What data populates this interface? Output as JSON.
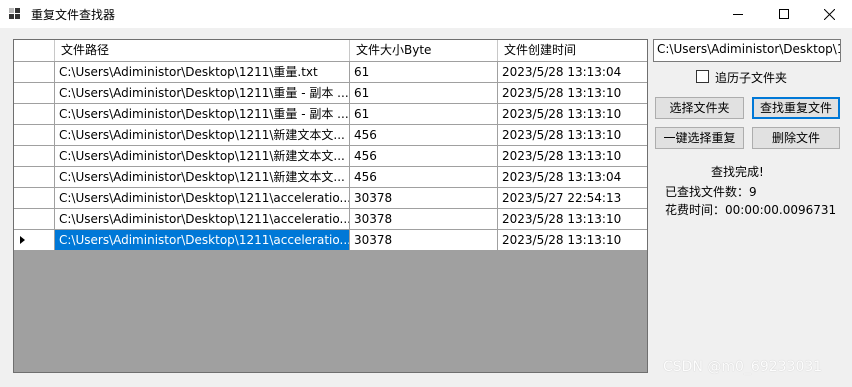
{
  "window": {
    "title": "重复文件查找器"
  },
  "grid": {
    "headers": [
      "",
      "文件路径",
      "文件大小Byte",
      "文件创建时间"
    ],
    "rows": [
      {
        "path": "C:\\Users\\Adiministor\\Desktop\\1211\\重量.txt",
        "size": "61",
        "created": "2023/5/28 13:13:04",
        "selected": false
      },
      {
        "path": "C:\\Users\\Adiministor\\Desktop\\1211\\重量 - 副本 ...",
        "size": "61",
        "created": "2023/5/28 13:13:10",
        "selected": false
      },
      {
        "path": "C:\\Users\\Adiministor\\Desktop\\1211\\重量 - 副本 ...",
        "size": "61",
        "created": "2023/5/28 13:13:10",
        "selected": false
      },
      {
        "path": "C:\\Users\\Adiministor\\Desktop\\1211\\新建文本文...",
        "size": "456",
        "created": "2023/5/28 13:13:10",
        "selected": false
      },
      {
        "path": "C:\\Users\\Adiministor\\Desktop\\1211\\新建文本文...",
        "size": "456",
        "created": "2023/5/28 13:13:10",
        "selected": false
      },
      {
        "path": "C:\\Users\\Adiministor\\Desktop\\1211\\新建文本文...",
        "size": "456",
        "created": "2023/5/28 13:13:04",
        "selected": false
      },
      {
        "path": "C:\\Users\\Adiministor\\Desktop\\1211\\acceleratio...",
        "size": "30378",
        "created": "2023/5/27 22:54:13",
        "selected": false
      },
      {
        "path": "C:\\Users\\Adiministor\\Desktop\\1211\\acceleratio...",
        "size": "30378",
        "created": "2023/5/28 13:13:10",
        "selected": false
      },
      {
        "path": "C:\\Users\\Adiministor\\Desktop\\1211\\acceleratio...",
        "size": "30378",
        "created": "2023/5/28 13:13:10",
        "selected": true
      }
    ]
  },
  "panel": {
    "path_value": "C:\\Users\\Adiministor\\Desktop\\1211",
    "recurse_label": "追历子文件夹",
    "recurse_checked": false,
    "select_folder_label": "选择文件夹",
    "find_dup_label": "查找重复文件",
    "select_dup_label": "一键选择重复",
    "delete_label": "删除文件",
    "status_text": "查找完成!",
    "count_text": "已查找文件数：9",
    "elapsed_text": "花费时间：00:00:00.0096731"
  },
  "watermark": "CSDN @m0_69233031",
  "colors": {
    "selection": "#0078d7",
    "grid_empty": "#a0a0a0",
    "window_bg": "#f0f0f0"
  }
}
